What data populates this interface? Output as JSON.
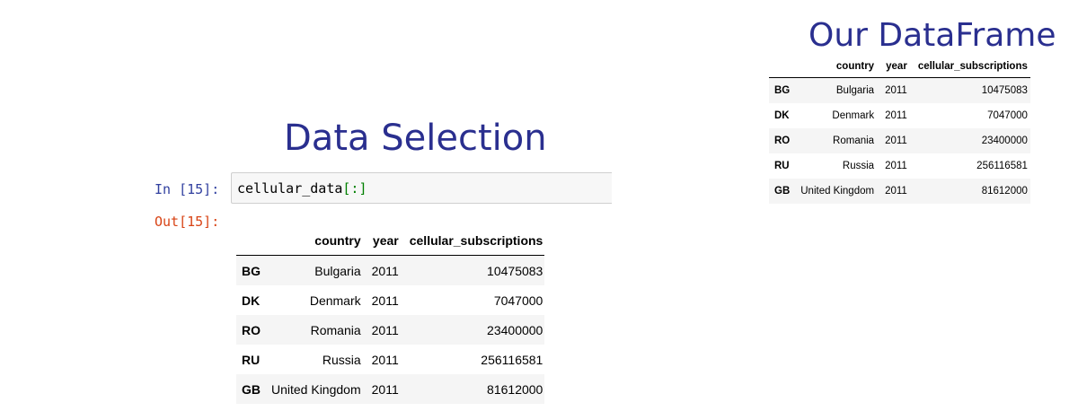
{
  "slide": {
    "title": "Data Selection",
    "dataframe_title": "Our DataFrame"
  },
  "notebook": {
    "in_prompt": "In [15]:",
    "out_prompt": "Out[15]:",
    "code_var": "cellular_data",
    "code_slice": "[:]"
  },
  "table": {
    "columns": [
      "",
      "country",
      "year",
      "cellular_subscriptions"
    ],
    "rows": [
      {
        "index": "BG",
        "country": "Bulgaria",
        "year": "2011",
        "cellular_subscriptions": "10475083"
      },
      {
        "index": "DK",
        "country": "Denmark",
        "year": "2011",
        "cellular_subscriptions": "7047000"
      },
      {
        "index": "RO",
        "country": "Romania",
        "year": "2011",
        "cellular_subscriptions": "23400000"
      },
      {
        "index": "RU",
        "country": "Russia",
        "year": "2011",
        "cellular_subscriptions": "256116581"
      },
      {
        "index": "GB",
        "country": "United Kingdom",
        "year": "2011",
        "cellular_subscriptions": "81612000"
      }
    ]
  },
  "colors": {
    "title": "#2a2f8f",
    "in_prompt": "#303f9f",
    "out_prompt": "#d84315",
    "code_slice": "#008000"
  }
}
